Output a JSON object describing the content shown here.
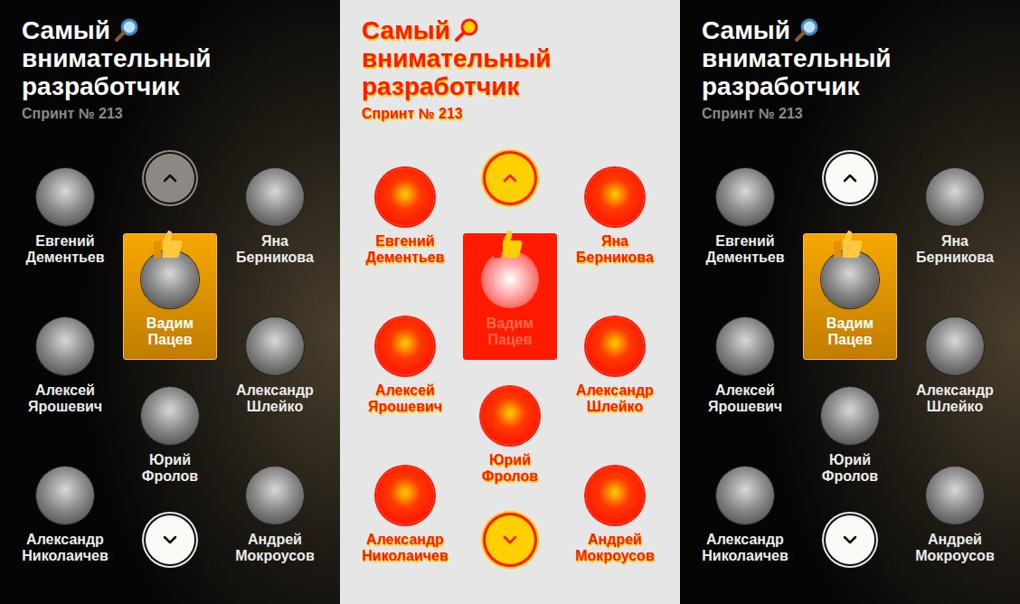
{
  "panels": [
    {
      "kind": "dark",
      "title_start": "Самый",
      "title_end": "внимательный разработчик",
      "sprint": "Спринт № 213",
      "up_disabled": true,
      "down_disabled": false,
      "left": [
        {
          "first": "Евгений",
          "last": "Дементьев",
          "selected": false
        },
        {
          "first": "Алексей",
          "last": "Ярошевич",
          "selected": false
        },
        {
          "first": "Александр",
          "last": "Николаичев",
          "selected": false
        }
      ],
      "center": [
        {
          "first": "Вадим",
          "last": "Пацев",
          "selected": true
        },
        {
          "first": "Юрий",
          "last": "Фролов",
          "selected": false
        }
      ],
      "right": [
        {
          "first": "Яна",
          "last": "Берникова",
          "selected": false
        },
        {
          "first": "Александр",
          "last": "Шлейко",
          "selected": false
        },
        {
          "first": "Андрей",
          "last": "Мокроусов",
          "selected": false
        }
      ]
    },
    {
      "kind": "diff",
      "title_start": "Самый",
      "title_end": "внимательный разработчик",
      "sprint": "Спринт № 213",
      "up_disabled": false,
      "down_disabled": false,
      "left": [
        {
          "first": "Евгений",
          "last": "Дементьев",
          "selected": false
        },
        {
          "first": "Алексей",
          "last": "Ярошевич",
          "selected": false
        },
        {
          "first": "Александр",
          "last": "Николаичев",
          "selected": false
        }
      ],
      "center": [
        {
          "first": "Вадим",
          "last": "Пацев",
          "selected": true
        },
        {
          "first": "Юрий",
          "last": "Фролов",
          "selected": false
        }
      ],
      "right": [
        {
          "first": "Яна",
          "last": "Берникова",
          "selected": false
        },
        {
          "first": "Александр",
          "last": "Шлейко",
          "selected": false
        },
        {
          "first": "Андрей",
          "last": "Мокроусов",
          "selected": false
        }
      ]
    },
    {
      "kind": "dark",
      "title_start": "Самый",
      "title_end": "внимательный разработчик",
      "sprint": "Спринт № 213",
      "up_disabled": false,
      "down_disabled": false,
      "left": [
        {
          "first": "Евгений",
          "last": "Дементьев",
          "selected": false
        },
        {
          "first": "Алексей",
          "last": "Ярошевич",
          "selected": false
        },
        {
          "first": "Александр",
          "last": "Николаичев",
          "selected": false
        }
      ],
      "center": [
        {
          "first": "Вадим",
          "last": "Пацев",
          "selected": true
        },
        {
          "first": "Юрий",
          "last": "Фролов",
          "selected": false
        }
      ],
      "right": [
        {
          "first": "Яна",
          "last": "Берникова",
          "selected": false
        },
        {
          "first": "Александр",
          "last": "Шлейко",
          "selected": false
        },
        {
          "first": "Андрей",
          "last": "Мокроусов",
          "selected": false
        }
      ]
    }
  ]
}
